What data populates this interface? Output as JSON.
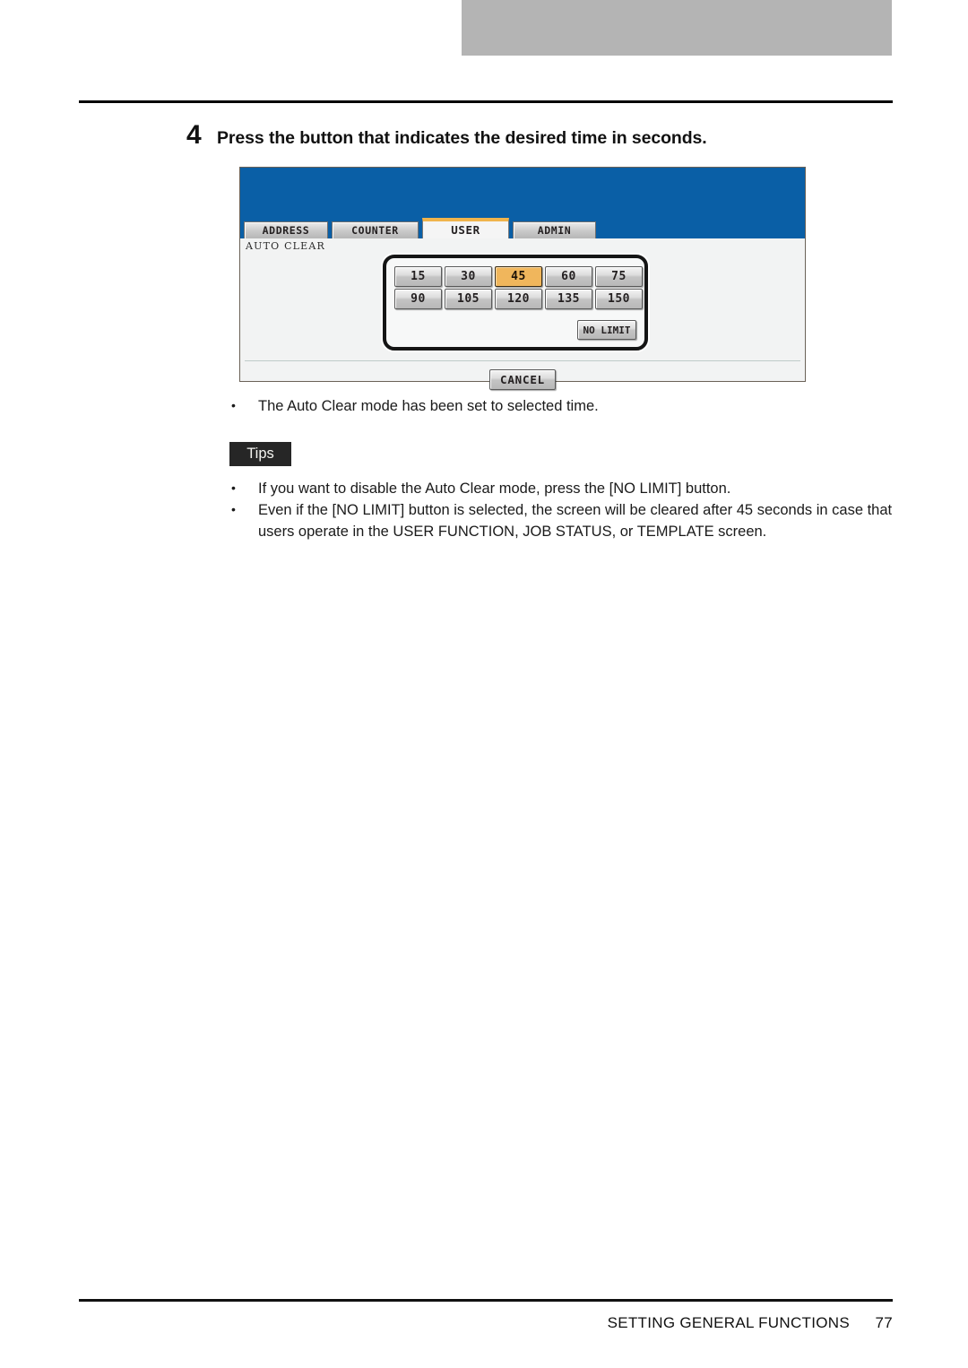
{
  "page": {
    "step_number": "4",
    "step_heading": "Press the button that indicates the desired time in seconds.",
    "note": "The Auto Clear mode has been set to selected time.",
    "tips_label": "Tips",
    "tips": [
      "If you want to disable the Auto Clear mode, press the [NO LIMIT] button.",
      "Even if the [NO LIMIT] button is selected, the screen will be cleared after 45 seconds in case that users operate in the USER FUNCTION, JOB STATUS, or TEMPLATE screen."
    ],
    "bullet_glyph": "•"
  },
  "panel": {
    "tabs": [
      {
        "label": "ADDRESS",
        "active": false
      },
      {
        "label": "COUNTER",
        "active": false
      },
      {
        "label": "USER",
        "active": true
      },
      {
        "label": "ADMIN",
        "active": false
      }
    ],
    "section_label": "AUTO CLEAR",
    "time_buttons": [
      {
        "label": "15",
        "selected": false
      },
      {
        "label": "30",
        "selected": false
      },
      {
        "label": "45",
        "selected": true
      },
      {
        "label": "60",
        "selected": false
      },
      {
        "label": "75",
        "selected": false
      },
      {
        "label": "90",
        "selected": false
      },
      {
        "label": "105",
        "selected": false
      },
      {
        "label": "120",
        "selected": false
      },
      {
        "label": "135",
        "selected": false
      },
      {
        "label": "150",
        "selected": false
      }
    ],
    "no_limit_label": "NO LIMIT",
    "cancel_label": "CANCEL",
    "colors": {
      "header_blue": "#0a5fa6",
      "selected_amber": "#f0b65c",
      "active_tab_accent": "#f0b44c",
      "panel_background": "#f2f3f3"
    }
  },
  "footer": {
    "title": "SETTING GENERAL FUNCTIONS",
    "page_number": "77"
  }
}
